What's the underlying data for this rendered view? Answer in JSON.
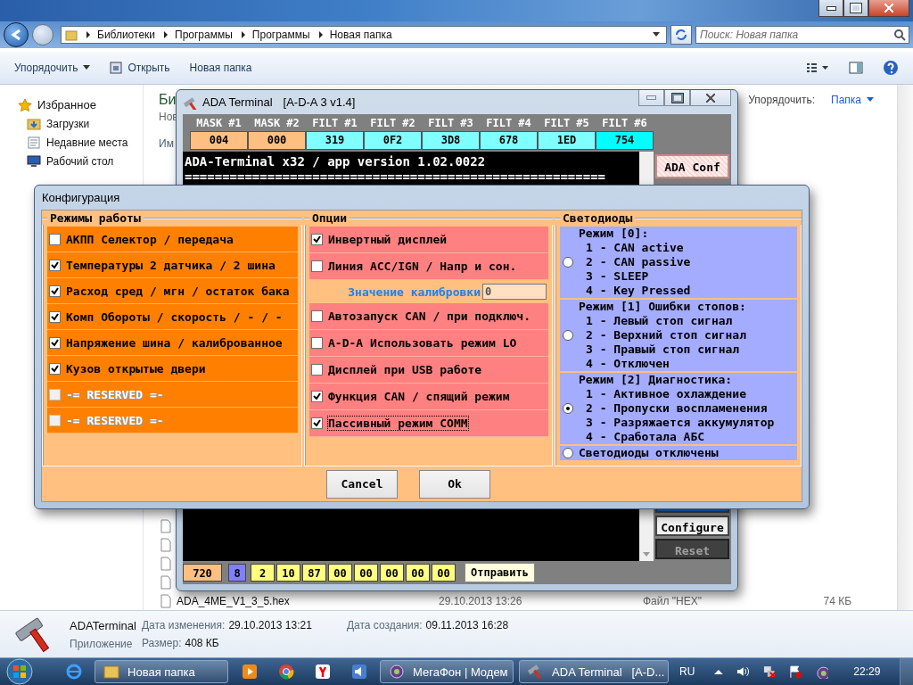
{
  "explorer": {
    "breadcrumb": [
      "Библиотеки",
      "Программы",
      "Программы",
      "Новая папка"
    ],
    "search": {
      "placeholder": "Поиск: Новая папка"
    },
    "toolbar": [
      {
        "label": "Упорядочить",
        "kind": "menu"
      },
      {
        "label": "Открыть",
        "kind": "open"
      },
      {
        "label": "Новая папка",
        "kind": "plain"
      }
    ],
    "nav": [
      {
        "label": "Избранное",
        "kind": "star"
      },
      {
        "label": "Загрузки",
        "kind": "download"
      },
      {
        "label": "Недавние места",
        "kind": "recent"
      },
      {
        "label": "Рабочий стол",
        "kind": "desktop"
      }
    ],
    "library_title": "Би",
    "library_subtitle": "Нов",
    "column_1": "Им",
    "arrange_label": "Упорядочить:",
    "arrange_value": "Папка",
    "files": [
      {
        "kind": "hidden"
      },
      {
        "kind": "hidden"
      },
      {
        "kind": "hidden"
      },
      {
        "kind": "hidden"
      },
      {
        "kind": "shown",
        "name": "ADA_4ME_V1_3_5.hex",
        "modified": "29.10.2013 13:26",
        "type": "Файл \"HEX\"",
        "size": "74 КБ"
      }
    ],
    "details": {
      "name": "ADATerminal",
      "type": "Приложение",
      "fields": [
        {
          "label": "Дата изменения:",
          "value": "29.10.2013 13:21"
        },
        {
          "label": "Размер:",
          "value": "408 КБ"
        },
        {
          "label": "Дата создания:",
          "value": "09.11.2013 16:28"
        }
      ]
    }
  },
  "terminal": {
    "title": "ADA Terminal",
    "subtitle": "[A-D-A 3 v1.4]",
    "filters": [
      {
        "label": "MASK #1",
        "value": "004",
        "color": "#ffbf80"
      },
      {
        "label": "MASK #2",
        "value": "000",
        "color": "#ffbf80"
      },
      {
        "label": "FILT #1",
        "value": "319",
        "color": "#80ffff"
      },
      {
        "label": "FILT #2",
        "value": "0F2",
        "color": "#80ffff"
      },
      {
        "label": "FILT #3",
        "value": "3D8",
        "color": "#80ffff"
      },
      {
        "label": "FILT #4",
        "value": "678",
        "color": "#80ffff"
      },
      {
        "label": "FILT #5",
        "value": "1ED",
        "color": "#80ffff"
      },
      {
        "label": "FILT #6",
        "value": "754",
        "color": "#00ffff"
      }
    ],
    "console": [
      "ADA-Terminal x32 / app version 1.02.0022",
      "========================================================"
    ],
    "buttons": [
      {
        "label": "ADA Conf",
        "kind": "conf"
      },
      {
        "kind": "flash"
      },
      {
        "label": "Configure",
        "kind": "normal"
      },
      {
        "label": "Reset",
        "kind": "dark"
      }
    ],
    "frame": [
      {
        "value": "720",
        "color": "#ffbf80"
      },
      {
        "value": "8",
        "color": "#8080ff"
      },
      {
        "value": "2",
        "color": "#ffff80"
      },
      {
        "value": "10",
        "color": "#ffff80"
      },
      {
        "value": "87",
        "color": "#ffff80"
      },
      {
        "value": "00",
        "color": "#ffff80"
      },
      {
        "value": "00",
        "color": "#ffff80"
      },
      {
        "value": "00",
        "color": "#ffff80"
      },
      {
        "value": "00",
        "color": "#ffff80"
      },
      {
        "value": "00",
        "color": "#ffff80"
      }
    ],
    "send_button": "Отправить"
  },
  "dialog": {
    "title": "Конфигурация",
    "modes": {
      "title": "Режимы работы",
      "items": [
        {
          "label": "АКПП Селектор / передача",
          "checked": false,
          "disabled": false
        },
        {
          "label": "Температуры 2 датчика / 2 шина",
          "checked": true,
          "disabled": false
        },
        {
          "label": "Расход сред / мгн / остаток бака",
          "checked": true,
          "disabled": false
        },
        {
          "label": "Комп Обороты / скорость / - / -",
          "checked": true,
          "disabled": false
        },
        {
          "label": "Напряжение шина / калиброванное",
          "checked": true,
          "disabled": false
        },
        {
          "label": "Кузов открытые двери",
          "checked": true,
          "disabled": false
        },
        {
          "label": "-= RESERVED =-",
          "checked": false,
          "disabled": true
        },
        {
          "label": "-= RESERVED =-",
          "checked": false,
          "disabled": true
        }
      ]
    },
    "options": {
      "title": "Опции",
      "items": [
        {
          "kind": "check",
          "label": "Инвертный дисплей",
          "checked": true,
          "focused": false
        },
        {
          "kind": "check",
          "label": "Линия ACC/IGN / Напр и сон.",
          "checked": false,
          "focused": false
        },
        {
          "kind": "field",
          "label": "Значение калибровки",
          "value": "0"
        },
        {
          "kind": "check",
          "label": "Автозапуск CAN / при подключ.",
          "checked": false,
          "focused": false
        },
        {
          "kind": "check",
          "label": "A-D-A Использовать режим LO",
          "checked": false,
          "focused": false
        },
        {
          "kind": "check",
          "label": "Дисплей при USB работе",
          "checked": false,
          "focused": false
        },
        {
          "kind": "check",
          "label": "Функция CAN / спящий режим",
          "checked": true,
          "focused": false
        },
        {
          "kind": "check",
          "label": "Пассивный режим COMM",
          "checked": true,
          "focused": true
        }
      ]
    },
    "leds": {
      "title": "Светодиоды",
      "modes": [
        {
          "heading": "Режим [0]:",
          "options": [
            "1 - CAN active",
            "2 - CAN passive",
            "3 - SLEEP",
            "4 - Key Pressed"
          ],
          "selected": false
        },
        {
          "heading": "Режим [1] Ошибки стопов:",
          "options": [
            "1 - Левый стоп сигнал",
            "2 - Верхний стоп сигнал",
            "3 - Правый стоп сигнал",
            "4 - Отключен"
          ],
          "selected": false
        },
        {
          "heading": "Режим [2] Диагностика:",
          "options": [
            "1 - Активное охлаждение",
            "2 - Пропуски воспламенения",
            "3 - Разряжается аккумулятор",
            "4 - Сработала АБС"
          ],
          "selected": true
        },
        {
          "heading": "Светодиоды отключены",
          "selected": false
        }
      ]
    },
    "buttons": [
      "Cancel",
      "Ok"
    ]
  },
  "taskbar": {
    "items": [
      {
        "kind": "ie"
      },
      {
        "kind": "folder",
        "label": "Новая папка"
      },
      {
        "kind": "media"
      },
      {
        "kind": "chrome"
      },
      {
        "kind": "yandex"
      },
      {
        "kind": "speaker"
      },
      {
        "kind": "globe",
        "label": "МегаФон | Модем"
      },
      {
        "kind": "hammer",
        "label": "ADA Terminal   [A-D..."
      }
    ],
    "language": "RU",
    "clock": "22:29"
  }
}
